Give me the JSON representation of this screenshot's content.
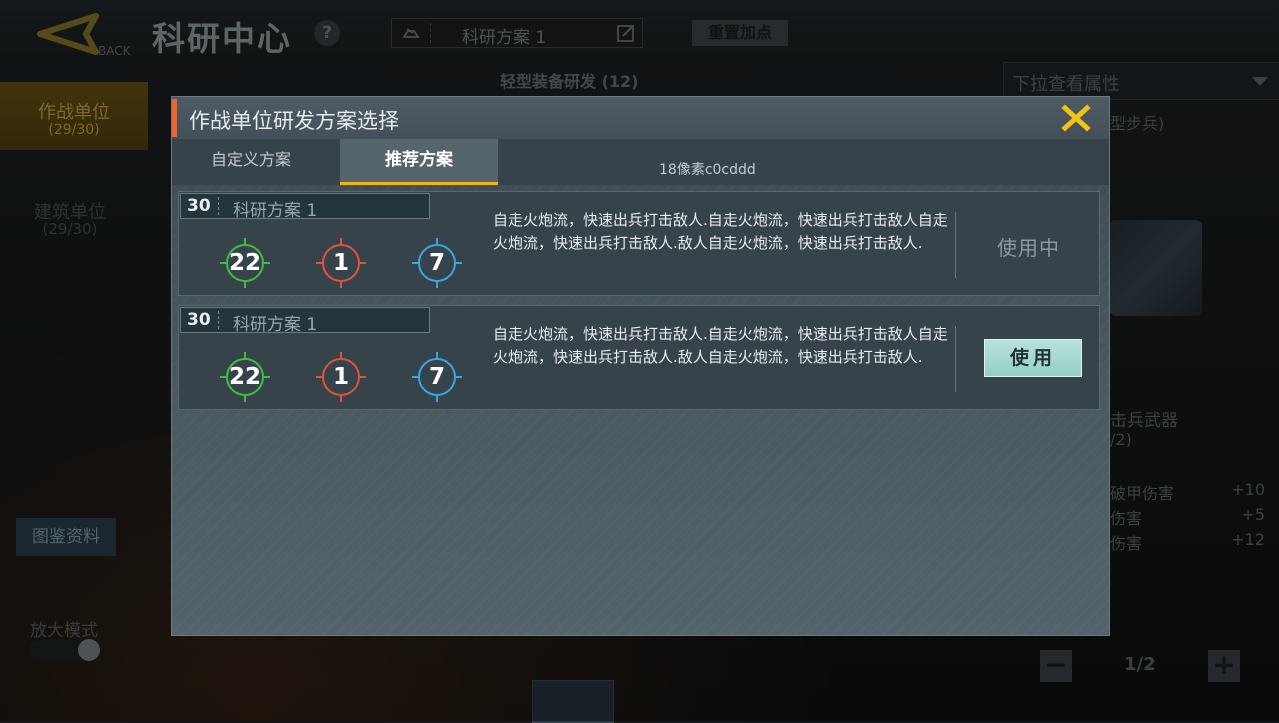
{
  "header": {
    "back_label": "BACK",
    "title": "科研中心",
    "help_symbol": "?",
    "scheme_name": "科研方案 1",
    "reset_label": "重置加点"
  },
  "subheader": {
    "title": "轻型装备研发 (12)"
  },
  "left_nav": {
    "items": [
      {
        "label": "作战单位",
        "count": "(29/30)",
        "active": true
      },
      {
        "label": "建筑单位",
        "count": "(29/30)",
        "active": false
      }
    ],
    "codex_label": "图鉴资料",
    "zoom_label": "放大模式"
  },
  "right_panel": {
    "dropdown_label": "下拉查看属性",
    "unit_type": "型步兵)",
    "weapon_label": "击兵武器",
    "weapon_count": "/2)",
    "stats": [
      {
        "name": "破甲伤害",
        "value": "+10"
      },
      {
        "name": "伤害",
        "value": "+5"
      },
      {
        "name": "伤害",
        "value": "+12"
      }
    ],
    "page": "1/2",
    "minus_symbol": "−",
    "plus_symbol": "+"
  },
  "dialog": {
    "title": "作战单位研发方案选择",
    "accent_color": "#e0683a",
    "close_color": "#f1c40f",
    "tabs": [
      {
        "label": "自定义方案",
        "active": false
      },
      {
        "label": "推荐方案",
        "active": true
      }
    ],
    "tab_note": "18像素c0cddd",
    "plans": [
      {
        "level": "30",
        "name": "科研方案 1",
        "stats": [
          {
            "value": "22",
            "color": "#3fbf3f"
          },
          {
            "value": "1",
            "color": "#e0533a"
          },
          {
            "value": "7",
            "color": "#3ba6e0"
          }
        ],
        "description": "自走火炮流，快速出兵打击敌人.自走火炮流，快速出兵打击敌人自走火炮流，快速出兵打击敌人.敌人自走火炮流，快速出兵打击敌人.",
        "status": "使用中"
      },
      {
        "level": "30",
        "name": "科研方案 1",
        "stats": [
          {
            "value": "22",
            "color": "#3fbf3f"
          },
          {
            "value": "1",
            "color": "#e0533a"
          },
          {
            "value": "7",
            "color": "#3ba6e0"
          }
        ],
        "description": "自走火炮流，快速出兵打击敌人.自走火炮流，快速出兵打击敌人自走火炮流，快速出兵打击敌人.敌人自走火炮流，快速出兵打击敌人.",
        "button": "使用"
      }
    ]
  }
}
